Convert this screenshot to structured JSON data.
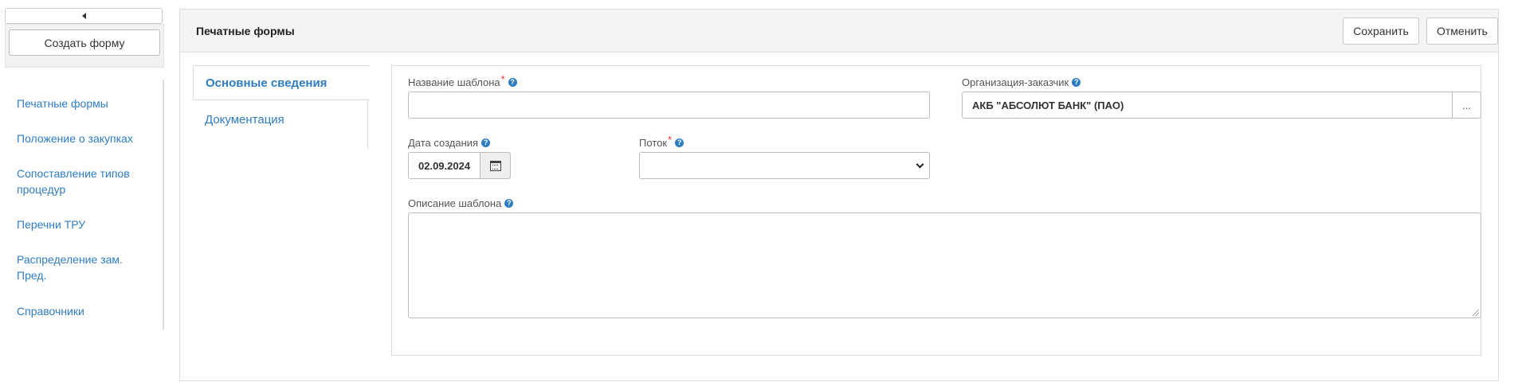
{
  "sidebar": {
    "create_button": "Создать форму",
    "items": [
      {
        "label": "Печатные формы"
      },
      {
        "label": "Положение о закупках"
      },
      {
        "label": "Сопоставление типов процедур"
      },
      {
        "label": "Перечни ТРУ"
      },
      {
        "label": "Распределение зам. Пред."
      },
      {
        "label": "Справочники"
      }
    ]
  },
  "header": {
    "title": "Печатные формы",
    "save_label": "Сохранить",
    "cancel_label": "Отменить"
  },
  "tabs": [
    {
      "label": "Основные сведения",
      "active": true
    },
    {
      "label": "Документация",
      "active": false
    }
  ],
  "form": {
    "template_name": {
      "label": "Название шаблона",
      "required_mark": "*",
      "value": ""
    },
    "customer_org": {
      "label": "Организация-заказчик",
      "value": "АКБ \"АБСОЛЮТ БАНК\" (ПАО)",
      "browse_label": "..."
    },
    "creation_date": {
      "label": "Дата создания",
      "value": "02.09.2024"
    },
    "flow": {
      "label": "Поток",
      "required_mark": "*",
      "value": ""
    },
    "description": {
      "label": "Описание шаблона",
      "value": ""
    },
    "help_glyph": "?"
  },
  "colors": {
    "link": "#2e7dc1",
    "required": "#e53935",
    "header_bg": "#f4f4f4"
  }
}
